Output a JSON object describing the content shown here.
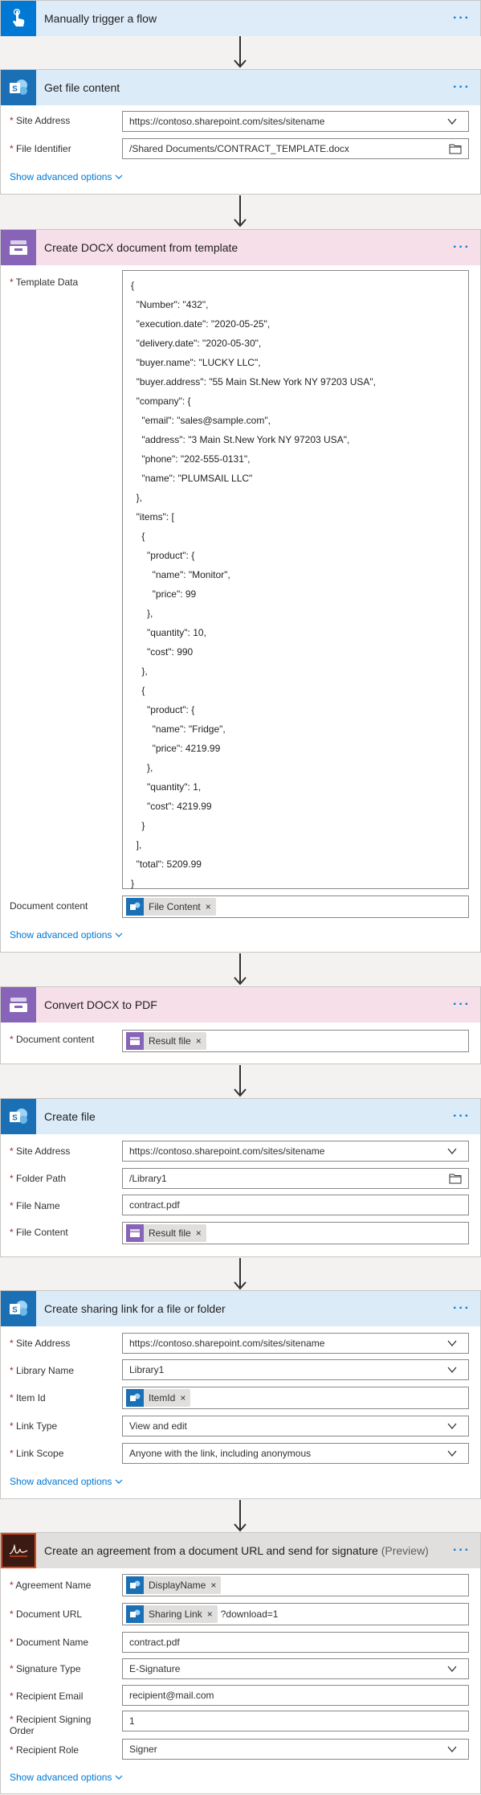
{
  "trigger": {
    "title": "Manually trigger a flow"
  },
  "get_file": {
    "title": "Get file content",
    "fields": [
      {
        "label": "Site Address",
        "value": "https://contoso.sharepoint.com/sites/sitename"
      },
      {
        "label": "File Identifier",
        "value": "/Shared Documents/CONTRACT_TEMPLATE.docx"
      }
    ],
    "advanced": "Show advanced options"
  },
  "create_docx": {
    "title": "Create DOCX document from template",
    "template_label": "Template Data",
    "template_lines": [
      "{",
      "  \"Number\": \"432\",",
      "  \"execution.date\": \"2020-05-25\",",
      "  \"delivery.date\": \"2020-05-30\",",
      "  \"buyer.name\": \"LUCKY LLC\",",
      "  \"buyer.address\": \"55 Main St.New York NY 97203 USA\",",
      "  \"company\": {",
      "    \"email\": \"sales@sample.com\",",
      "    \"address\": \"3 Main St.New York NY 97203 USA\",",
      "    \"phone\": \"202-555-0131\",",
      "    \"name\": \"PLUMSAIL LLC\"",
      "  },",
      "  \"items\": [",
      "    {",
      "      \"product\": {",
      "        \"name\": \"Monitor\",",
      "        \"price\": 99",
      "      },",
      "      \"quantity\": 10,",
      "      \"cost\": 990",
      "    },",
      "    {",
      "      \"product\": {",
      "        \"name\": \"Fridge\",",
      "        \"price\": 4219.99",
      "      },",
      "      \"quantity\": 1,",
      "      \"cost\": 4219.99",
      "    }",
      "  ],",
      "  \"total\": 5209.99",
      "}"
    ],
    "doc_content_label": "Document content",
    "doc_content_token": "File Content",
    "advanced": "Show advanced options"
  },
  "convert": {
    "title": "Convert DOCX to PDF",
    "label": "Document content",
    "token": "Result file"
  },
  "create_file": {
    "title": "Create file",
    "site_label": "Site Address",
    "site_value": "https://contoso.sharepoint.com/sites/sitename",
    "folder_label": "Folder Path",
    "folder_value": "/Library1",
    "name_label": "File Name",
    "name_value": "contract.pdf",
    "content_label": "File Content",
    "content_token": "Result file"
  },
  "sharing": {
    "title": "Create sharing link for a file or folder",
    "site_label": "Site Address",
    "site_value": "https://contoso.sharepoint.com/sites/sitename",
    "library_label": "Library Name",
    "library_value": "Library1",
    "item_label": "Item Id",
    "item_token": "ItemId",
    "type_label": "Link Type",
    "type_value": "View and edit",
    "scope_label": "Link Scope",
    "scope_value": "Anyone with the link, including anonymous",
    "advanced": "Show advanced options"
  },
  "agreement": {
    "title": "Create an agreement from a document URL and send for signature",
    "preview": "(Preview)",
    "name_label": "Agreement Name",
    "name_token": "DisplayName",
    "url_label": "Document URL",
    "url_token": "Sharing Link",
    "url_suffix": "?download=1",
    "docname_label": "Document Name",
    "docname_value": "contract.pdf",
    "sigtype_label": "Signature Type",
    "sigtype_value": "E-Signature",
    "email_label": "Recipient Email",
    "email_value": "recipient@mail.com",
    "order_label_1": "Recipient Signing",
    "order_label_2": "Order",
    "order_value": "1",
    "role_label": "Recipient Role",
    "role_value": "Signer",
    "advanced": "Show advanced options"
  },
  "colors": {
    "accent": "#0078d4",
    "required": "#a4262c",
    "sharepoint": "#1a6fb5",
    "plumsail": "#8764b8"
  }
}
